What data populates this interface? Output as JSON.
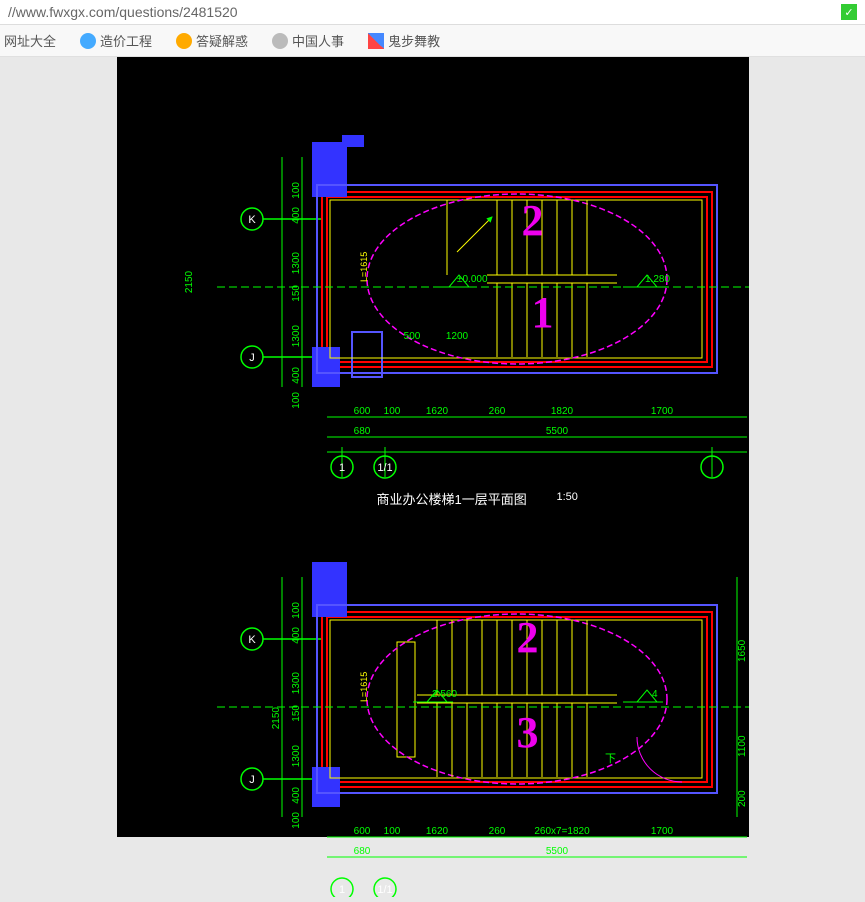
{
  "address": "//www.fwxgx.com/questions/2481520",
  "bookmarks": [
    "网址大全",
    "造价工程",
    "答疑解惑",
    "中国人事",
    "鬼步舞教"
  ],
  "drawing_title": "商业办公楼梯1一层平面图",
  "scale": "1:50",
  "grid_labels": {
    "top_left": "K",
    "bot_left": "J",
    "bot_a": "1",
    "bot_b": "1/1"
  },
  "dims_vertical": [
    "100",
    "400",
    "1300",
    "150",
    "1300",
    "400",
    "100",
    "2150"
  ],
  "dims_horizontal_top": [
    "600",
    "100",
    "1620",
    "260",
    "1820",
    "1700"
  ],
  "dims_horizontal_bot": [
    "680",
    "5500"
  ],
  "elevations": {
    "top": "±0.000",
    "right": "1.280",
    "p2a": "2.560",
    "p2b": "4"
  },
  "inner_dims": [
    "500",
    "1200"
  ],
  "p2_extra": [
    "260x7=1820",
    "1650",
    "1100",
    "200"
  ],
  "annotations": {
    "a1": "2",
    "a2": "1",
    "a3": "2",
    "a4": "3"
  },
  "beam": "L=1615"
}
